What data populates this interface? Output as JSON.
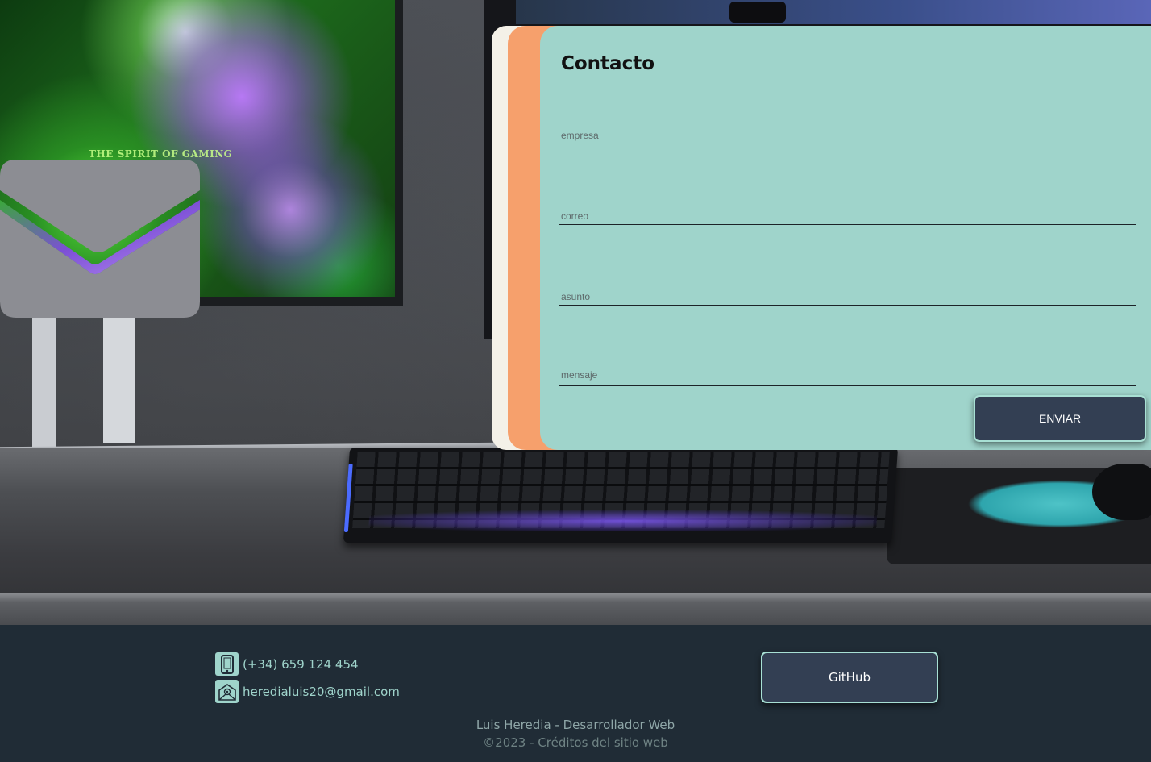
{
  "contact_form": {
    "title": "Contacto",
    "fields": [
      {
        "name": "empresa",
        "placeholder": "empresa",
        "value": ""
      },
      {
        "name": "correo",
        "placeholder": "correo",
        "value": ""
      },
      {
        "name": "asunto",
        "placeholder": "asunto",
        "value": ""
      },
      {
        "name": "mensaje",
        "placeholder": "mensaje",
        "value": ""
      }
    ],
    "submit_label": "ENVIAR"
  },
  "background": {
    "monitor_text": "THE SPIRIT OF GAMING"
  },
  "footer": {
    "phone": "(+34) 659 124 454",
    "email": "heredialuis20@gmail.com",
    "github_label": "GitHub",
    "author_line": "Luis Heredia - Desarrollador Web",
    "copyright_line": "©2023 - Créditos del sitio web"
  },
  "icons": {
    "envelope": "envelope-icon",
    "phone": "phone-icon",
    "email": "email-icon"
  },
  "colors": {
    "card": "#9fd4cb",
    "card_accent": "#f6a06c",
    "card_back": "#f4f1e8",
    "button": "#333f53",
    "button_border": "#a8e0d4",
    "footer_bg": "#202c36",
    "footer_text": "#9fd4cb"
  }
}
